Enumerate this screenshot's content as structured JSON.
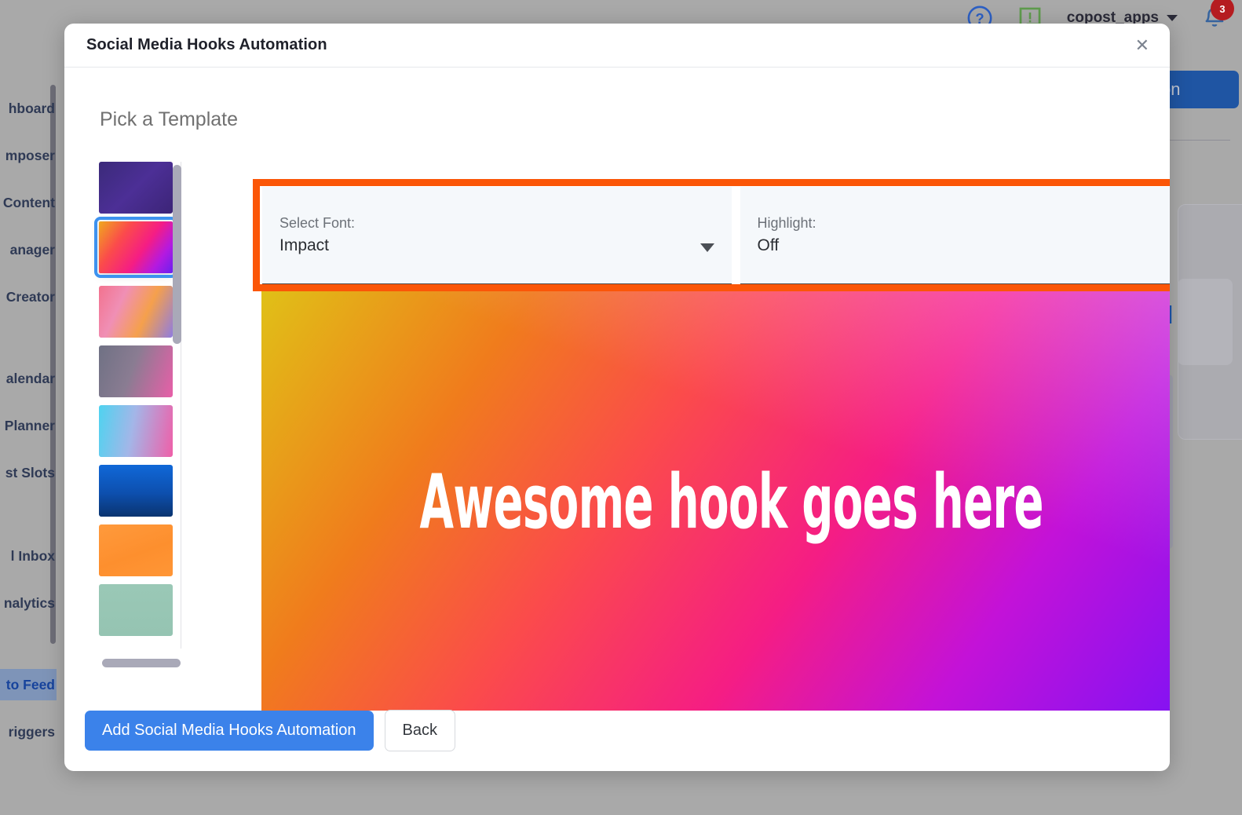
{
  "background": {
    "lock_icon": "lock-icon",
    "topbar": {
      "help_icon": "question-circle-icon",
      "feedback_icon": "message-alert-icon",
      "username": "copost_apps",
      "dropdown_icon": "chevron-down-icon",
      "bell_icon": "bell-icon",
      "bell_badge": "3"
    },
    "sidebar_items": [
      {
        "label": "hboard",
        "active": false
      },
      {
        "label": "mposer",
        "active": false
      },
      {
        "label": "Content",
        "active": false
      },
      {
        "label": "anager",
        "active": false
      },
      {
        "label": "Creator",
        "active": false
      },
      {
        "label": "alendar",
        "active": false
      },
      {
        "label": "Planner",
        "active": false
      },
      {
        "label": "st Slots",
        "active": false
      },
      {
        "label": "l Inbox",
        "active": false
      },
      {
        "label": "nalytics",
        "active": false
      },
      {
        "label": "to Feed",
        "active": true
      },
      {
        "label": "riggers",
        "active": false
      }
    ],
    "right_button_partial": "on",
    "right_bracket_partial": "]"
  },
  "modal": {
    "title": "Social Media Hooks Automation",
    "close_icon": "close-icon",
    "section_heading": "Pick a Template",
    "controls": {
      "font_select": {
        "label": "Select Font:",
        "value": "Impact",
        "arrow_icon": "chevron-down-icon"
      },
      "highlight_select": {
        "label": "Highlight:",
        "value": "Off",
        "arrow_icon": "chevron-down-icon"
      }
    },
    "preview": {
      "text": "Awesome hook goes here"
    },
    "footer": {
      "primary_label": "Add Social Media Hooks Automation",
      "secondary_label": "Back"
    },
    "templates": [
      {
        "name": "template-purple-stripes",
        "selected": false,
        "css": "linear-gradient(135deg,#3b2a7a 0%,#4c2f96 50%,#3c2477 100%)"
      },
      {
        "name": "template-orange-pink-purple",
        "selected": true,
        "css": "linear-gradient(125deg,#f0a81e 0%,#fb4b4b 30%,#f51d84 58%,#b41ae0 80%,#6a20f0 100%)"
      },
      {
        "name": "template-pink-orange-grain",
        "selected": false,
        "css": "linear-gradient(115deg,#f2728e 0%,#f08fb5 30%,#f5a04c 62%,#8f7ce0 100%)"
      },
      {
        "name": "template-slate-pink",
        "selected": false,
        "css": "linear-gradient(110deg,#6f7184 0%,#8a7c92 45%,#e85fa8 100%)"
      },
      {
        "name": "template-cyan-pink",
        "selected": false,
        "css": "linear-gradient(100deg,#4ed3f0 0%,#a3b6e8 45%,#ef5fa8 100%)"
      },
      {
        "name": "template-deep-blue",
        "selected": false,
        "css": "linear-gradient(180deg,#1068d8 0%,#0d4fae 55%,#0a3470 100%)"
      },
      {
        "name": "template-orange-solid",
        "selected": false,
        "css": "linear-gradient(160deg,#ff9a3c 0%,#fd8f2e 55%,#ff9636 100%)"
      },
      {
        "name": "template-sage-green",
        "selected": false,
        "css": "linear-gradient(180deg,#9ac8b6 0%,#95c4b2 100%)"
      }
    ],
    "accent_highlight_color": "#fb5607",
    "selected_outline_color": "#3d92ef",
    "primary_button_color": "#3b82ea"
  }
}
